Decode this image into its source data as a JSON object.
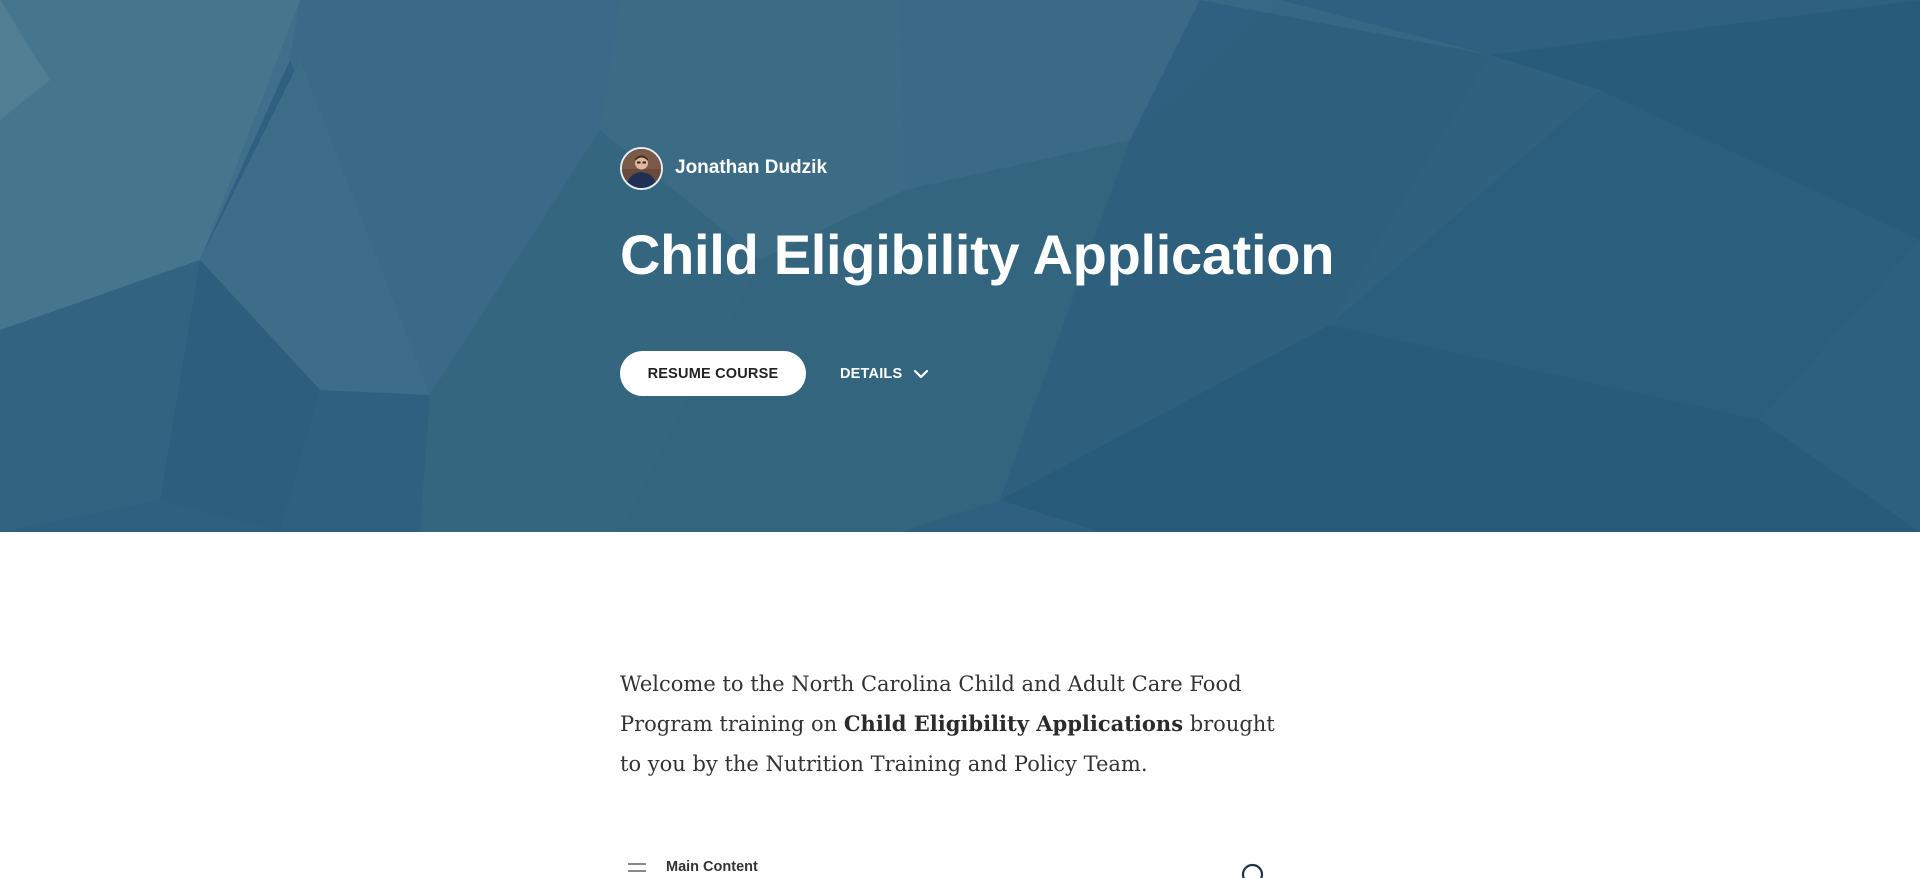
{
  "hero": {
    "author_name": "Jonathan Dudzik",
    "course_title": "Child Eligibility Application",
    "resume_label": "RESUME COURSE",
    "details_label": "DETAILS",
    "background_color": "#2f6080"
  },
  "intro": {
    "text_before": "Welcome to the North Carolina Child and Adult Care Food Program training on ",
    "bold_text": "Child Eligibility Applications",
    "text_after": " brought to you by the Nutrition Training and Policy Team."
  },
  "lesson_list": {
    "first_item_label": "Main Content"
  },
  "icons": {
    "avatar": "author-avatar",
    "details": "chevron-down-icon",
    "menu": "menu-lines-icon",
    "progress": "progress-circle-icon"
  }
}
